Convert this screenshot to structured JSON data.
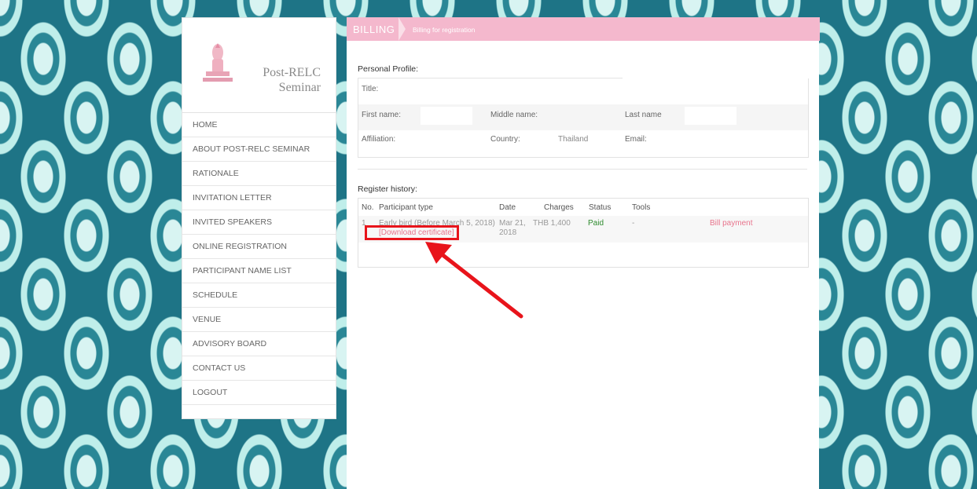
{
  "sidebar": {
    "logo_line1": "Post-RELC",
    "logo_line2": "Seminar",
    "items": [
      {
        "label": "HOME"
      },
      {
        "label": "ABOUT POST-RELC SEMINAR"
      },
      {
        "label": "RATIONALE"
      },
      {
        "label": "INVITATION LETTER"
      },
      {
        "label": "INVITED SPEAKERS"
      },
      {
        "label": "ONLINE REGISTRATION"
      },
      {
        "label": "PARTICIPANT NAME LIST"
      },
      {
        "label": "SCHEDULE"
      },
      {
        "label": "VENUE"
      },
      {
        "label": "ADVISORY BOARD"
      },
      {
        "label": "CONTACT US"
      },
      {
        "label": "LOGOUT"
      }
    ]
  },
  "header": {
    "title": "BILLING",
    "subtitle": "Billing for registration"
  },
  "profile": {
    "heading": "Personal Profile:",
    "title_label": "Title:",
    "first_name_label": "First name:",
    "middle_name_label": "Middle name:",
    "last_name_label": "Last name",
    "affiliation_label": "Affiliation:",
    "country_label": "Country:",
    "country_value": "Thailand",
    "email_label": "Email:"
  },
  "history": {
    "heading": "Register history:",
    "columns": [
      "No.",
      "Participant type",
      "Date",
      "Charges",
      "Status",
      "Tools"
    ],
    "rows": [
      {
        "no": "1",
        "participant_type": "Early bird (Before March 5, 2018)",
        "certificate_link": "[Download certificate]",
        "date_line1": "Mar 21,",
        "date_line2": "2018",
        "charges": "THB 1,400",
        "status": "Paid",
        "tools": "-",
        "action": "Bill payment"
      }
    ]
  },
  "colors": {
    "accent_pink": "#f4b8cd",
    "link_pink": "#e8748c",
    "paid_green": "#2e8b2e",
    "annotation_red": "#e8141b",
    "background_teal": "#1e7486"
  }
}
